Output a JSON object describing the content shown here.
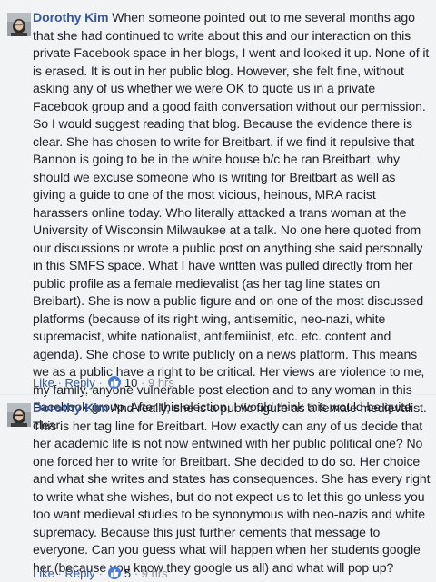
{
  "comments": [
    {
      "author": "Dorothy Kim",
      "text": "When someone pointed out to me several months ago that she had continued to write about this and our interaction on this private Facebook space in her blogs, I went and looked it up. None of it is erased. It is out in her public blog. However, she felt fine, without asking any of us whether we were OK to quote us in a private Facebook group and a good faith conversation without our permission. So I would suggest reading that blog. Because the evidence there is clear. She has chosen to write for Breitbart. if we find it repulsive that Bannon is going to be in the white house b/c he ran Breitbart, why should we excuse someone who is writing for Breitbart as well as giving a guide to one of the most vicious, heinous, MRA racist harassers online today. Who literally attacked a trans woman at the University of Wisconsin Milwaukee at a talk. No one here quoted from our discussions or wrote a public post on anything she said personally in this SMFS space. What I have written was pulled directly from her public profile as a female medievalist (as her tag line states on Breibart). She is now a public figure and on one of the most discussed platforms (because of its right wing, antisemitic, neo-nazi, white supremacist, white nationalist, antifemiinist, etc. etc. content and agenda). She chose to write publicly on a news platform. This means we as a public have a right to be critical. Her views are violence to me, my family, anyone vulnerable post election and to any woman in this Facebook group. After this election, I would think this would be quite clear.",
      "like_label": "Like",
      "reply_label": "Reply",
      "like_count": "10",
      "time": "9 hrs",
      "icon": "thumbs-up-icon"
    },
    {
      "author": "Dorothy Kim",
      "text": "And really, she is a public figure as a female medievalist. This is her tag line for Breitbart. How exactly can any of us decide that her academic life is not now entwined with her public political one? No one forced her to write for Breitbart. She decided to do so. Her choice and what she writes and states has consequences. She has every right to write what she wishes, but do not expect us to let this go unless you too want medieval studies to be synonymous with neo-nazis and white supremacy. Because this just further cements that message to everyone. Can you guess what will happen when her students google her (because you know they google us all) and what will pop up?",
      "like_label": "Like",
      "reply_label": "Reply",
      "like_count": "5",
      "time": "9 hrs",
      "icon": "thumbs-up-icon"
    }
  ],
  "separator": "·",
  "colors": {
    "link": "#365899",
    "meta": "#90949c",
    "background": "#f2f3f5",
    "like_badge": "#4a7bd8"
  }
}
